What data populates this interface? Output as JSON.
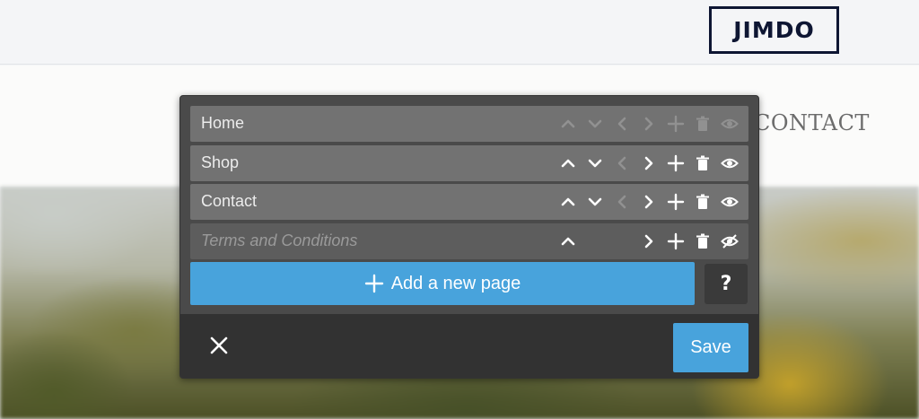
{
  "brand": {
    "logo_text": "JIMDO"
  },
  "site_nav": {
    "contact_label": "CONTACT"
  },
  "editor": {
    "pages": [
      {
        "label": "Home",
        "hidden": false,
        "controls": {
          "move_up": false,
          "move_down": false,
          "outdent": false,
          "indent": false,
          "add": false,
          "delete": false,
          "visibility": false
        }
      },
      {
        "label": "Shop",
        "hidden": false,
        "controls": {
          "move_up": true,
          "move_down": true,
          "outdent": false,
          "indent": true,
          "add": true,
          "delete": true,
          "visibility": true
        }
      },
      {
        "label": "Contact",
        "hidden": false,
        "controls": {
          "move_up": true,
          "move_down": true,
          "outdent": false,
          "indent": true,
          "add": true,
          "delete": true,
          "visibility": true
        }
      },
      {
        "label": "Terms and Conditions",
        "hidden": true,
        "controls": {
          "move_up": true,
          "move_down": null,
          "outdent": null,
          "indent": true,
          "add": true,
          "delete": true,
          "visibility": true
        }
      }
    ],
    "add_page_label": "Add a new page",
    "help_label": "?",
    "save_label": "Save"
  },
  "icons": {
    "row_controls": [
      "chevron-up-icon",
      "chevron-down-icon",
      "chevron-left-icon",
      "chevron-right-icon",
      "plus-icon",
      "trash-icon",
      "eye-icon"
    ],
    "hidden_row_visibility": "eye-slash-icon",
    "add": "plus-icon",
    "close": "close-icon"
  },
  "colors": {
    "accent": "#48a3dc",
    "panel": "#4a4a4a",
    "row": "#727272",
    "footer": "#323232",
    "logo": "#0e1633"
  }
}
